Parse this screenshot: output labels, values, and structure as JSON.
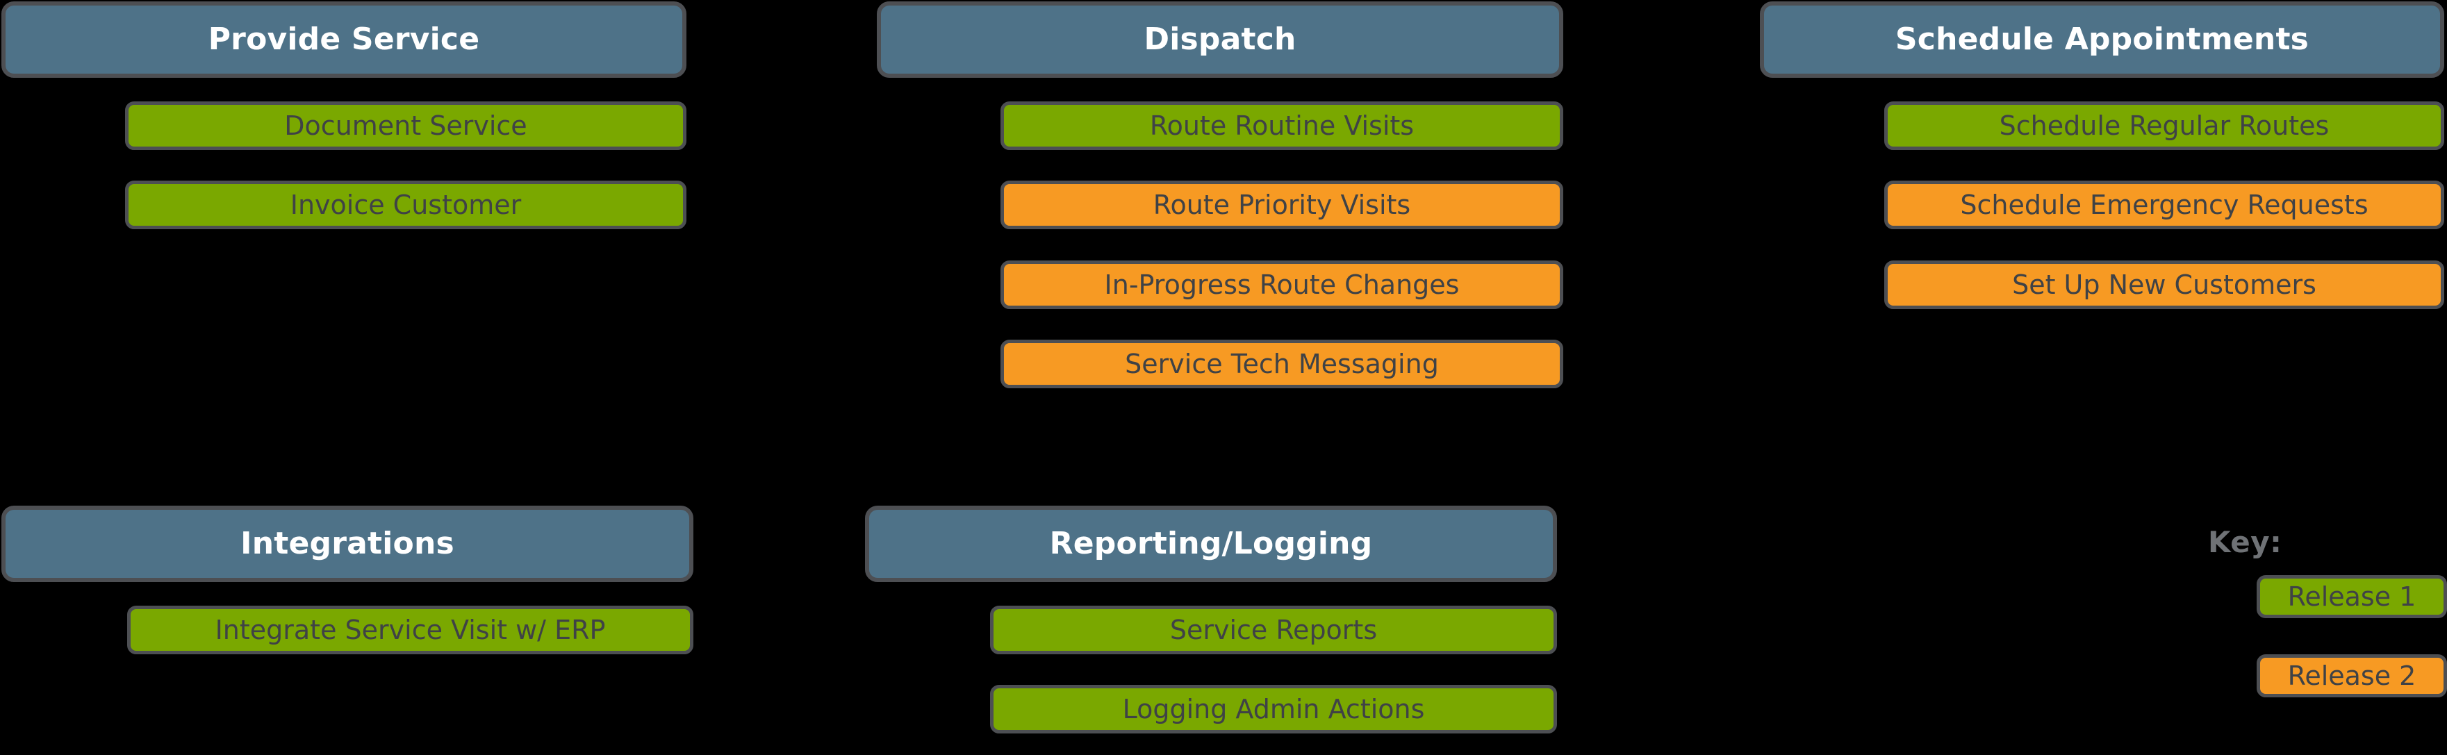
{
  "background_color": "#000000",
  "colors": {
    "group_header": "#4e7288",
    "release_1": "#7aa800",
    "release_2": "#f79a23",
    "border": "#4d4f53",
    "header_text": "#ffffff",
    "task_text": "#3f4246",
    "key_label_text": "#6f7276"
  },
  "groups": [
    {
      "title": "Provide Service",
      "tasks": [
        {
          "label": "Document Service",
          "release": "release_1"
        },
        {
          "label": "Invoice Customer",
          "release": "release_1"
        }
      ]
    },
    {
      "title": "Dispatch",
      "tasks": [
        {
          "label": "Route Routine Visits",
          "release": "release_1"
        },
        {
          "label": "Route Priority Visits",
          "release": "release_2"
        },
        {
          "label": "In-Progress Route Changes",
          "release": "release_2"
        },
        {
          "label": "Service Tech Messaging",
          "release": "release_2"
        }
      ]
    },
    {
      "title": "Schedule Appointments",
      "tasks": [
        {
          "label": "Schedule Regular Routes",
          "release": "release_1"
        },
        {
          "label": "Schedule Emergency Requests",
          "release": "release_2"
        },
        {
          "label": "Set Up New Customers",
          "release": "release_2"
        }
      ]
    },
    {
      "title": "Integrations",
      "tasks": [
        {
          "label": "Integrate Service Visit w/ ERP",
          "release": "release_1"
        }
      ]
    },
    {
      "title": "Reporting/Logging",
      "tasks": [
        {
          "label": "Service Reports",
          "release": "release_1"
        },
        {
          "label": "Logging Admin Actions",
          "release": "release_1"
        }
      ]
    }
  ],
  "key": {
    "title": "Key:",
    "items": [
      {
        "label": "Release 1",
        "release": "release_1"
      },
      {
        "label": "Release 2",
        "release": "release_2"
      }
    ]
  }
}
